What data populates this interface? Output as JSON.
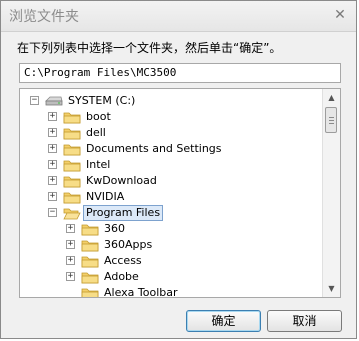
{
  "window": {
    "title": "浏览文件夹",
    "close_glyph": "✕"
  },
  "prompt": "在下列列表中选择一个文件夹，然后单击“确定”。",
  "path_value": "C:\\Program Files\\MC3500",
  "tree": {
    "root": "SYSTEM (C:)",
    "folders": [
      "boot",
      "dell",
      "Documents and Settings",
      "Intel",
      "KwDownload",
      "NVIDIA"
    ],
    "selected": "Program Files",
    "children": [
      "360",
      "360Apps",
      "Access",
      "Adobe",
      "Alexa Toolbar"
    ]
  },
  "buttons": {
    "ok": "确定",
    "cancel": "取消"
  },
  "colors": {
    "selection_bg": "#dce9f8",
    "folder_fill": "#f3cf6a"
  }
}
